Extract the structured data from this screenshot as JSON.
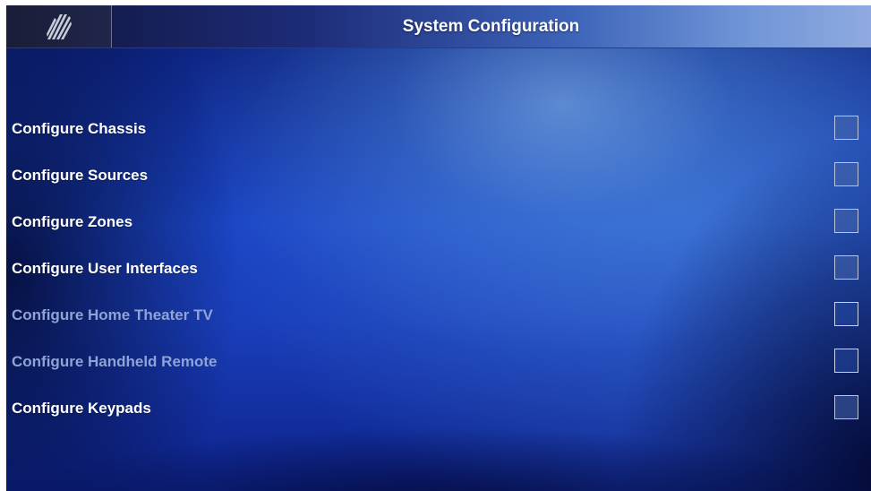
{
  "header": {
    "logo_icon": "brand-logo-icon",
    "title": "System Configuration"
  },
  "menu": {
    "items": [
      {
        "label": "Configure Chassis",
        "enabled": true
      },
      {
        "label": "Configure Sources",
        "enabled": true
      },
      {
        "label": "Configure Zones",
        "enabled": true
      },
      {
        "label": "Configure User Interfaces",
        "enabled": true
      },
      {
        "label": "Configure Home Theater TV",
        "enabled": false
      },
      {
        "label": "Configure Handheld Remote",
        "enabled": false
      },
      {
        "label": "Configure Keypads",
        "enabled": true
      }
    ]
  },
  "colors": {
    "label_enabled": "#ffffff",
    "label_disabled": "#8ea3d6",
    "background_primary": "#1b46c6"
  }
}
